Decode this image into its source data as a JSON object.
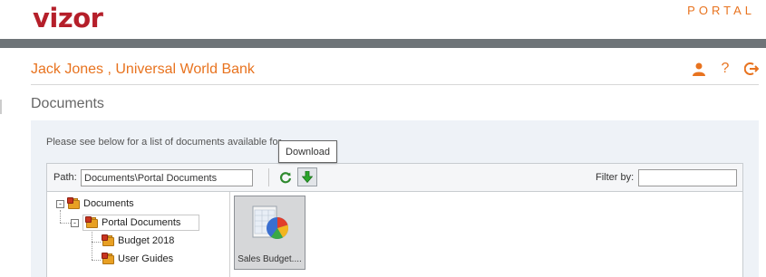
{
  "header": {
    "logo": "vizor",
    "portal": "PORTAL"
  },
  "user": {
    "title": "Jack Jones , Universal World Bank",
    "icons": [
      "user-icon",
      "help-icon",
      "logout-icon"
    ],
    "help_glyph": "?"
  },
  "page": {
    "title": "Documents",
    "intro": "Please see below for a list of documents available for"
  },
  "toolbar": {
    "path_label": "Path:",
    "path_value": "Documents\\Portal Documents",
    "filter_label": "Filter by:",
    "filter_value": "",
    "tooltip": "Download"
  },
  "tree": {
    "nodes": [
      {
        "label": "Documents",
        "toggle": "-"
      },
      {
        "label": "Portal Documents",
        "toggle": "-"
      },
      {
        "label": "Budget 2018"
      },
      {
        "label": "User Guides"
      }
    ]
  },
  "files": [
    {
      "name": "Sales Budget...."
    }
  ],
  "colors": {
    "brand_red": "#b51f2a",
    "accent_orange": "#e8731f",
    "header_bar": "#6e7478",
    "panel_bg": "#eef2f7"
  }
}
